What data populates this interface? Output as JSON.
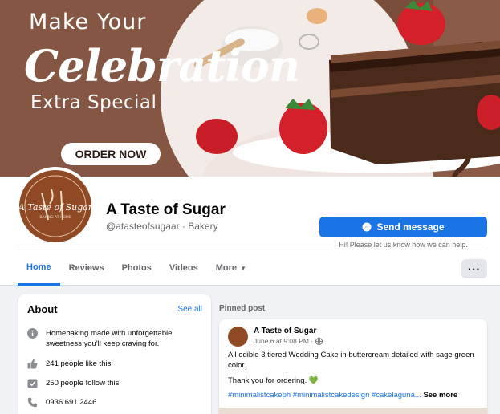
{
  "cover": {
    "line1": "Make Your",
    "line2": "Celebration",
    "line3": "Extra Special",
    "order_button": "ORDER NOW"
  },
  "page": {
    "name": "A Taste of Sugar",
    "subtitle": "@atasteofsugaar · Bakery",
    "avatar_text": "A Taste of Sugar",
    "avatar_subtext": "BAKING AT HOME"
  },
  "actions": {
    "send_message": "Send message",
    "send_note": "Hi! Please let us know how we can help."
  },
  "tabs": [
    {
      "label": "Home"
    },
    {
      "label": "Reviews"
    },
    {
      "label": "Photos"
    },
    {
      "label": "Videos"
    },
    {
      "label": "More"
    }
  ],
  "more_menu": "···",
  "about": {
    "title": "About",
    "see_all": "See all",
    "description": "Homebaking made with unforgettable sweetness you'll keep craving for.",
    "likes": "241 people like this",
    "follows": "250 people follow this",
    "phone": "0936 691 2446"
  },
  "pinned": {
    "label": "Pinned post",
    "author": "A Taste of Sugar",
    "time": "June 6 at 9:08 PM ·",
    "body": "All edible 3 tiered Wedding Cake in buttercream detailed with sage green color.",
    "thanks": "Thank you for ordering. 💚",
    "hashtags": "#minimalistcakeph #minimalistcakedesign #cakelaguna...",
    "see_more": "See more"
  },
  "colors": {
    "accent": "#1b74e4",
    "brand_brown": "#8f4a25",
    "background": "#f0f2f5"
  }
}
